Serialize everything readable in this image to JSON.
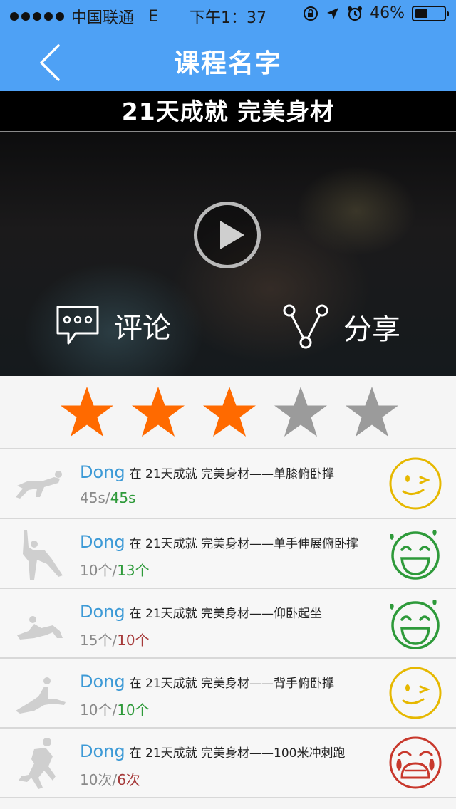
{
  "status_bar": {
    "carrier": "中国联通",
    "network": "E",
    "time": "下午1：37",
    "battery": "46%",
    "battery_level": 0.46
  },
  "nav": {
    "title": "课程名字",
    "back_icon": "chevron-left-icon"
  },
  "course": {
    "banner_title": "21天成就 完美身材"
  },
  "video": {
    "play_icon": "play-icon",
    "comment_label": "评论",
    "share_label": "分享"
  },
  "rating": {
    "value": 3,
    "max": 5,
    "filled_color": "#ff6a00",
    "empty_color": "#9b9b9b"
  },
  "feed": {
    "items": [
      {
        "user": "Dong",
        "text": "在 21天成就 完美身材——单膝俯卧撑",
        "target": "45s",
        "done": "45s",
        "status": "good",
        "thumb_icon": "kneeling-pushup-icon",
        "face_icon": "wink-face-icon",
        "face_color": "#e6b800"
      },
      {
        "user": "Dong",
        "text": "在 21天成就 完美身材——单手伸展俯卧撑",
        "target": "10个",
        "done": "13个",
        "status": "good",
        "thumb_icon": "side-plank-icon",
        "face_icon": "laughing-face-icon",
        "face_color": "#2e9a3a"
      },
      {
        "user": "Dong",
        "text": "在 21天成就 完美身材——仰卧起坐",
        "target": "15个",
        "done": "10个",
        "status": "bad",
        "thumb_icon": "situp-icon",
        "face_icon": "laughing-face-icon",
        "face_color": "#2e9a3a"
      },
      {
        "user": "Dong",
        "text": "在 21天成就 完美身材——背手俯卧撑",
        "target": "10个",
        "done": "10个",
        "status": "good",
        "thumb_icon": "reverse-pushup-icon",
        "face_icon": "wink-face-icon",
        "face_color": "#e6b800"
      },
      {
        "user": "Dong",
        "text": "在 21天成就 完美身材——100米冲刺跑",
        "target": "10次",
        "done": "6次",
        "status": "bad",
        "thumb_icon": "sprint-icon",
        "face_icon": "crying-face-icon",
        "face_color": "#c8382c"
      }
    ]
  }
}
